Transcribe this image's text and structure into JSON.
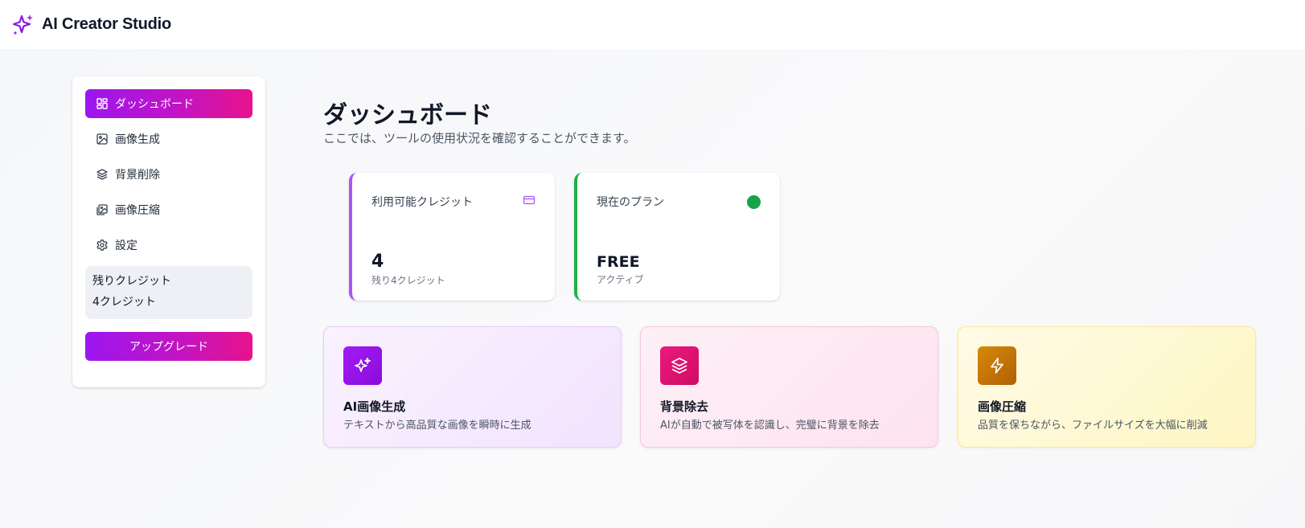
{
  "header": {
    "brand": "AI Creator Studio",
    "brand_icon": "sparkles-icon"
  },
  "sidebar": {
    "items": [
      {
        "label": "ダッシュボード",
        "icon": "dashboard-icon",
        "active": true
      },
      {
        "label": "画像生成",
        "icon": "image-icon",
        "active": false
      },
      {
        "label": "背景削除",
        "icon": "layers-icon",
        "active": false
      },
      {
        "label": "画像圧縮",
        "icon": "images-icon",
        "active": false
      },
      {
        "label": "設定",
        "icon": "gear-icon",
        "active": false
      }
    ],
    "credits_title": "残りクレジット",
    "credits_value": "4クレジット",
    "upgrade_label": "アップグレード"
  },
  "main": {
    "title": "ダッシュボード",
    "subtitle": "ここでは、ツールの使用状況を確認することができます。",
    "stats": [
      {
        "label": "利用可能クレジット",
        "value": "4",
        "sub": "残り4クレジット",
        "icon": "credit-card-icon",
        "accent": "#a855f7"
      },
      {
        "label": "現在のプラン",
        "value": "FREE",
        "sub": "アクティブ",
        "icon": "status-dot",
        "accent": "#22b04b"
      }
    ],
    "features": [
      {
        "title": "AI画像生成",
        "desc": "テキストから高品質な画像を瞬時に生成",
        "icon": "sparkles-icon",
        "color": "#a21cf5"
      },
      {
        "title": "背景除去",
        "desc": "AIが自動で被写体を認識し、完璧に背景を除去",
        "icon": "layers-icon",
        "color": "#ea1a7f"
      },
      {
        "title": "画像圧縮",
        "desc": "品質を保ちながら、ファイルサイズを大幅に削減",
        "icon": "zap-icon",
        "color": "#d58a06"
      }
    ]
  },
  "colors": {
    "brand_gradient_start": "#9b16f0",
    "brand_gradient_end": "#e8128a",
    "active_dot": "#16a34a"
  }
}
